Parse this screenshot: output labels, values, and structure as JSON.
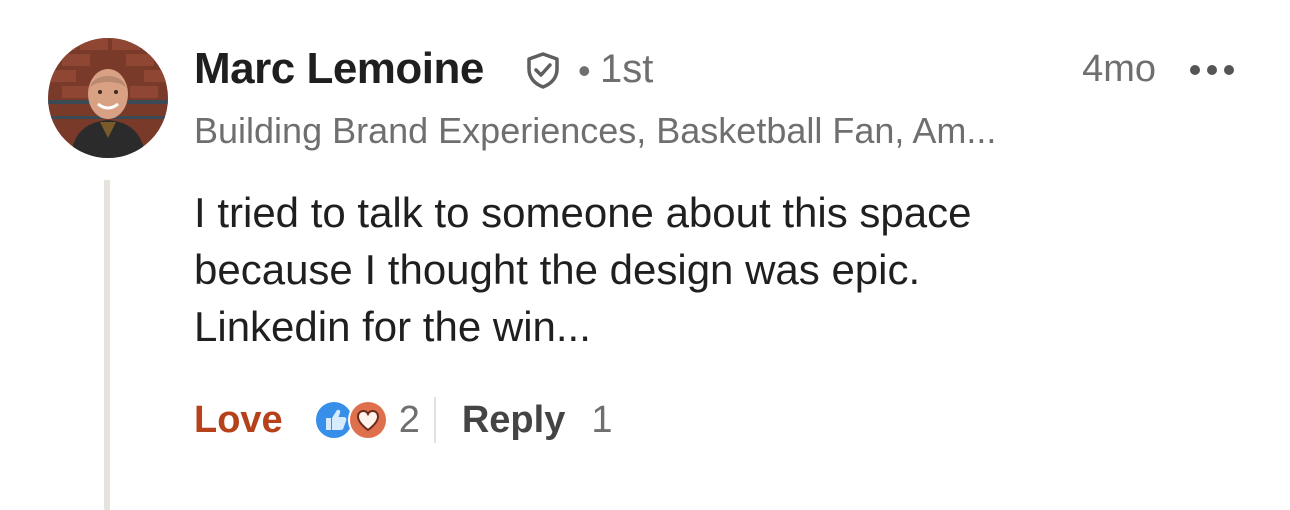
{
  "comment": {
    "author": {
      "name": "Marc Lemoine",
      "degree": "1st",
      "headline": "Building Brand Experiences, Basketball Fan, Am...",
      "verified": true,
      "avatar": "profile-photo"
    },
    "separator": "•",
    "time_ago": "4mo",
    "text": "I tried to talk to someone about this space\nbecause I thought the design was epic.\nLinkedin for the win...",
    "actions": {
      "reaction_label": "Love",
      "reaction_icons": [
        "like-icon",
        "heart-icon"
      ],
      "reaction_count": "2",
      "reply_label": "Reply",
      "reply_count": "1"
    }
  },
  "colors": {
    "love": "#b5421b",
    "muted": "#6f6f6f",
    "like_blue": "#378fe9",
    "heart_orange": "#df704d",
    "thread_line": "#e6e3dc"
  }
}
